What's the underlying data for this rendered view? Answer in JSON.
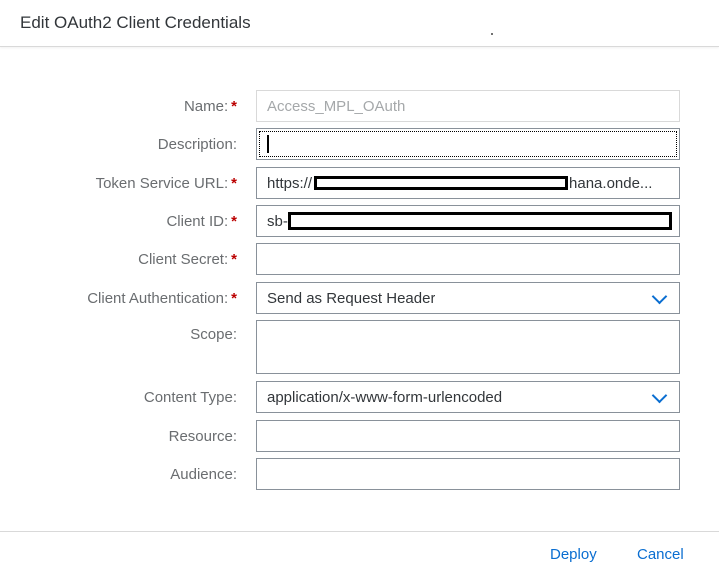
{
  "dialog": {
    "title": "Edit OAuth2 Client Credentials"
  },
  "form": {
    "name": {
      "label": "Name:",
      "value": "Access_MPL_OAuth"
    },
    "description": {
      "label": "Description:",
      "value": ""
    },
    "token_service_url": {
      "label": "Token Service URL:",
      "value_prefix": "https://",
      "value_suffix": "hana.onde..."
    },
    "client_id": {
      "label": "Client ID:",
      "value_prefix": "sb-"
    },
    "client_secret": {
      "label": "Client Secret:",
      "value": ""
    },
    "client_authentication": {
      "label": "Client Authentication:",
      "value": "Send as Request Header"
    },
    "scope": {
      "label": "Scope:",
      "value": ""
    },
    "content_type": {
      "label": "Content Type:",
      "value": "application/x-www-form-urlencoded"
    },
    "resource": {
      "label": "Resource:",
      "value": ""
    },
    "audience": {
      "label": "Audience:",
      "value": ""
    },
    "required_marker": "*"
  },
  "footer": {
    "deploy_label": "Deploy",
    "cancel_label": "Cancel"
  },
  "colors": {
    "accent": "#0a6ed1",
    "required": "#bb0000",
    "label": "#6a6d70"
  },
  "icons": {
    "dropdown": "chevron-down-icon"
  }
}
